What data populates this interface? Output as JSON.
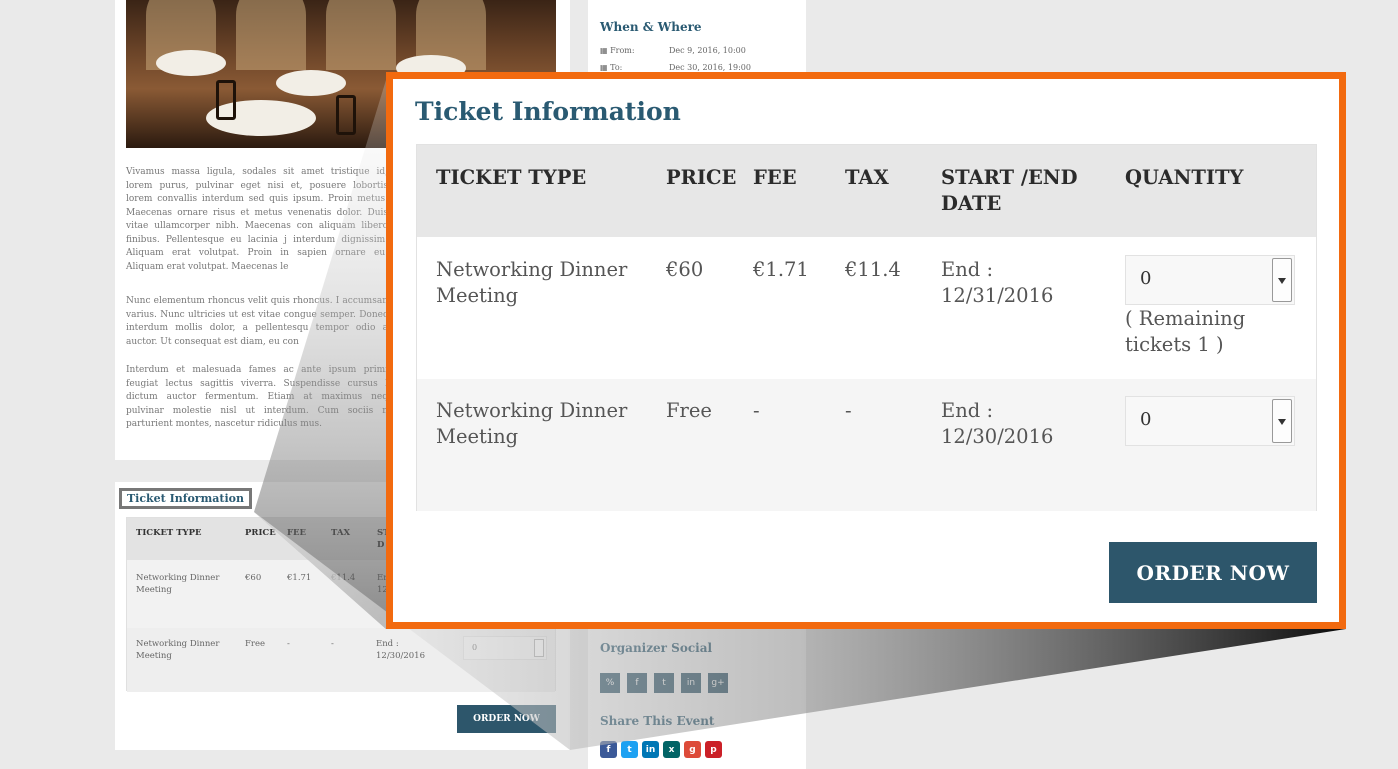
{
  "colors": {
    "accent": "#2a5a72",
    "button": "#2d566b",
    "highlight_border": "#f26a0f"
  },
  "background": {
    "paragraphs": [
      "Vivamus massa ligula, sodales sit amet tristique id, lorem purus, pulvinar eget nisi et, posuere lobortis lorem convallis interdum sed quis ipsum. Proin metus. Maecenas ornare risus et metus venenatis dolor. Duis vitae ullamcorper nibh. Maecenas con aliquam libero finibus. Pellentesque eu lacinia j interdum dignissim. Aliquam erat volutpat. Proin in sapien ornare eu. Aliquam erat volutpat. Maecenas le",
      "Nunc elementum rhoncus velit quis rhoncus. I accumsan varius. Nunc ultricies ut est vitae congue semper. Donec interdum mollis dolor, a pellentesqu tempor odio a auctor. Ut consequat est diam, eu con",
      "Interdum et malesuada fames ac ante ipsum primi feugiat lectus sagittis viverra. Suspendisse cursus l dictum auctor fermentum. Etiam at maximus neq pulvinar molestie nisl ut interdum. Cum sociis n parturient montes, nascetur ridiculus mus."
    ],
    "small_ticket": {
      "title": "Ticket Information",
      "headers": [
        "TICKET TYPE",
        "PRICE",
        "FEE",
        "TAX",
        "ST D"
      ],
      "row1": {
        "type": "Networking Dinner Meeting",
        "price": "€60",
        "fee": "€1.71",
        "tax": "€11.4",
        "date": "Er 12"
      },
      "row2": {
        "type": "Networking Dinner Meeting",
        "price": "Free",
        "fee": "-",
        "tax": "-",
        "date": "End : 12/30/2016",
        "qty": "0"
      },
      "order_label": "ORDER NOW"
    },
    "sidebar": {
      "when_where_title": "When & Where",
      "from_label": "From:",
      "from_value": "Dec 9, 2016, 10:00",
      "to_label": "To:",
      "to_value": "Dec 30, 2016, 19:00",
      "organizer_social_title": "Organizer Social",
      "social_icons": [
        "link-icon",
        "facebook-icon",
        "twitter-icon",
        "linkedin-icon",
        "google-plus-icon"
      ],
      "share_title": "Share This Event",
      "share_icons": [
        "facebook-icon",
        "twitter-icon",
        "linkedin-icon",
        "xing-icon",
        "google-plus-icon",
        "pinterest-icon"
      ]
    }
  },
  "zoom": {
    "title": "Ticket Information",
    "headers": {
      "ticket_type": "TICKET TYPE",
      "price": "PRICE",
      "fee": "FEE",
      "tax": "TAX",
      "date_line1": "START /END",
      "date_line2": "DATE",
      "quantity": "QUANTITY"
    },
    "rows": [
      {
        "type_line1": "Networking Dinner",
        "type_line2": "Meeting",
        "price": "€60",
        "fee": "€1.71",
        "tax": "€11.4",
        "date_line1": "End :",
        "date_line2": "12/31/2016",
        "qty": "0",
        "remaining_line1": "( Remaining",
        "remaining_line2": "tickets 1 )"
      },
      {
        "type_line1": "Networking Dinner",
        "type_line2": "Meeting",
        "price": "Free",
        "fee": "-",
        "tax": "-",
        "date_line1": "End :",
        "date_line2": "12/30/2016",
        "qty": "0"
      }
    ],
    "order_label": "ORDER NOW"
  }
}
